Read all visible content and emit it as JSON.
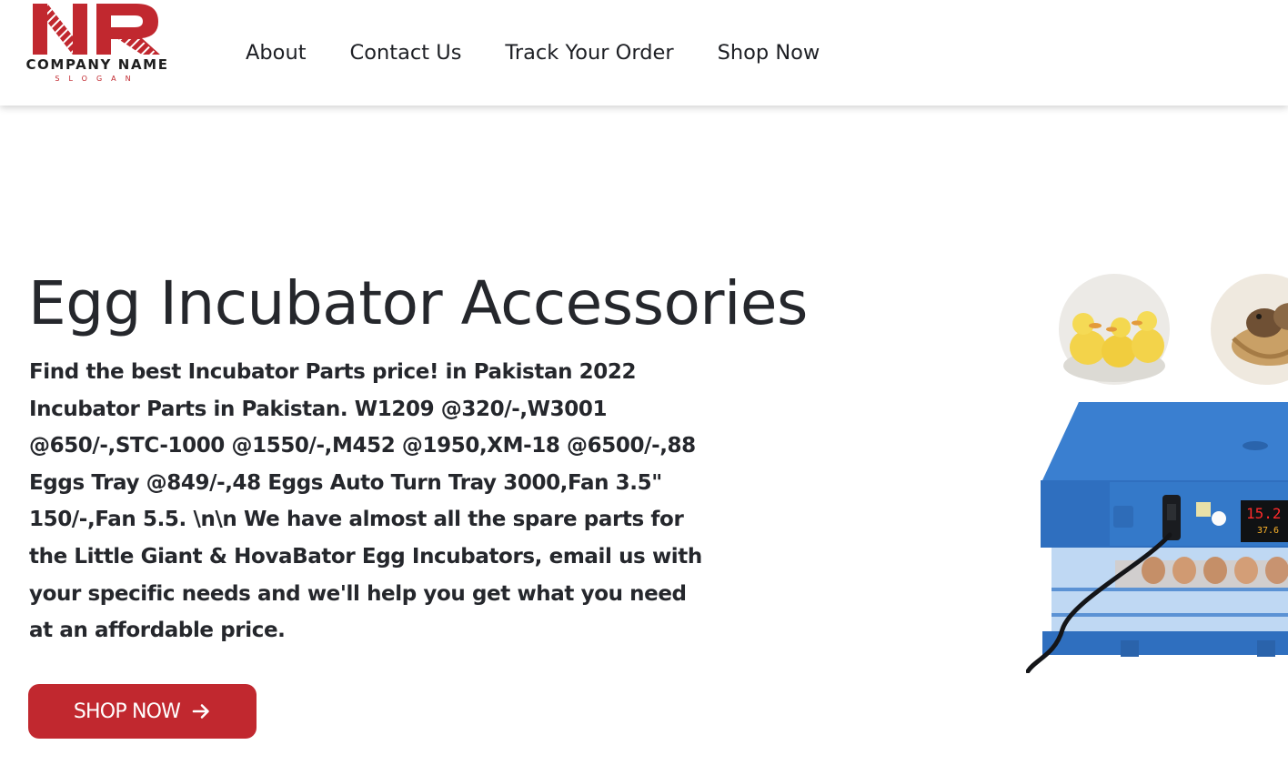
{
  "brand": {
    "logo_letters": "NR",
    "company_name": "COMPANY NAME",
    "slogan": "SLOGAN",
    "accent_color": "#c1282f"
  },
  "nav": {
    "items": [
      {
        "label": "About"
      },
      {
        "label": "Contact Us"
      },
      {
        "label": "Track Your Order"
      },
      {
        "label": "Shop Now"
      }
    ]
  },
  "hero": {
    "title": "Egg Incubator Accessories",
    "description": "Find the best Incubator Parts price! in Pakistan 2022 Incubator Parts in Pakistan. W1209 @320/-,W3001 @650/-,STC-1000 @1550/-,M452 @1950,XM-18 @6500/-,88 Eggs Tray @849/-,48 Eggs Auto Turn Tray 3000,Fan 3.5\" 150/-,Fan 5.5. \\n\\n We have almost all the spare parts for the Little Giant & HovaBator Egg Incubators, email us with your specific needs and we'll help you get what you need at an affordable price.",
    "cta_label": "SHOP NOW",
    "cta_icon": "arrow-right-icon",
    "incubator_display_temp": "15.2",
    "incubator_display_sub": "37.6"
  }
}
